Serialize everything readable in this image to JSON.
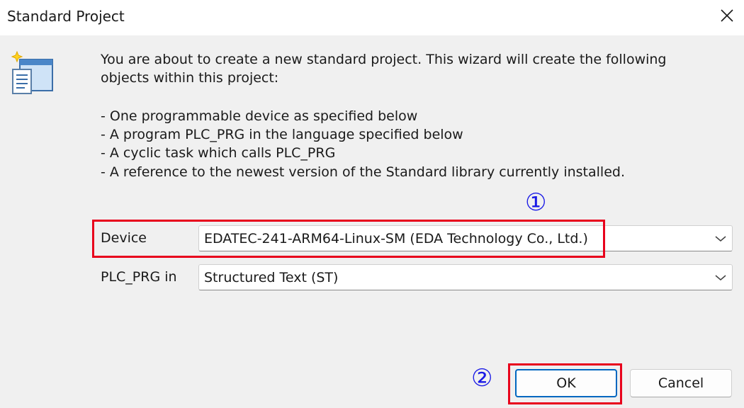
{
  "window": {
    "title": "Standard Project"
  },
  "icons": {
    "close": "close-icon",
    "wizard": "wizard-icon",
    "dropdown": "chevron-down-icon"
  },
  "description": {
    "intro_line1": "You are about to create a new standard project. This wizard will create the following",
    "intro_line2": "objects within this project:",
    "items": [
      "- One programmable device as specified below",
      "- A program PLC_PRG in the language specified below",
      "- A cyclic task which calls PLC_PRG",
      "- A reference to the newest version of the Standard library currently installed."
    ]
  },
  "form": {
    "device_label": "Device",
    "device_value": "EDATEC-241-ARM64-Linux-SM (EDA Technology Co., Ltd.)",
    "plc_prg_label": "PLC_PRG in",
    "plc_prg_value": "Structured Text (ST)"
  },
  "buttons": {
    "ok": "OK",
    "cancel": "Cancel"
  },
  "annotations": {
    "step1": "①",
    "step2": "②",
    "highlight_color": "#e8001c",
    "marker_color": "#1a1ae6"
  },
  "colors": {
    "accent": "#0067c0",
    "background": "#f0f0f0"
  }
}
